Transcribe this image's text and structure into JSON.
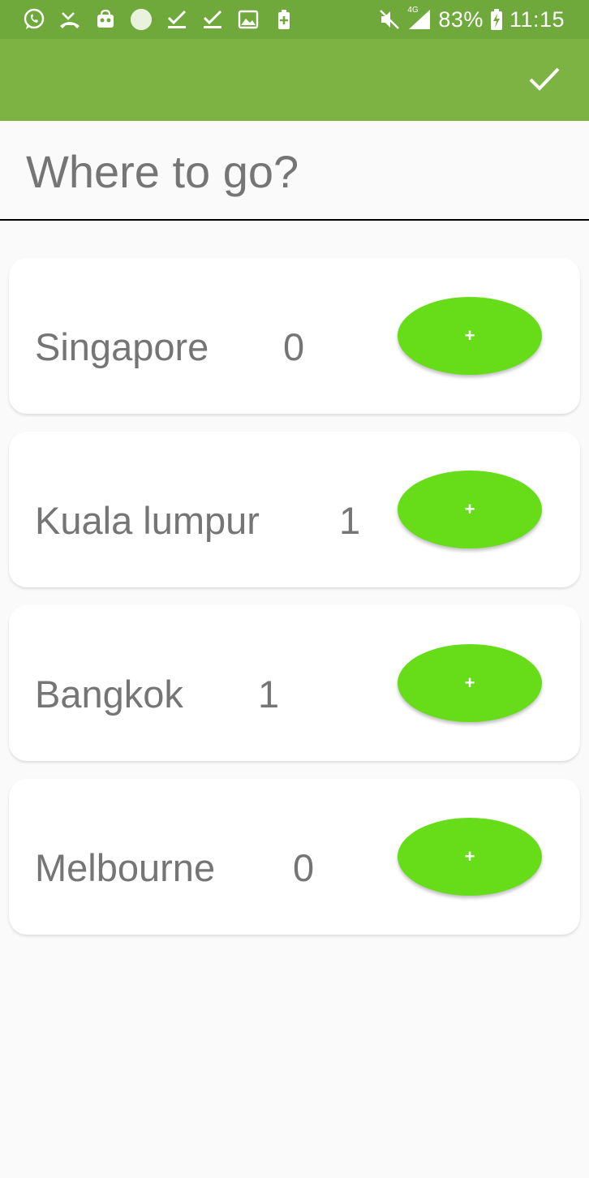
{
  "status_bar": {
    "icons_left": [
      "whatsapp-icon",
      "missed-call-icon",
      "shopping-bag-icon",
      "circle-icon",
      "download-done-icon",
      "download-done-icon",
      "image-icon",
      "battery-plus-icon"
    ],
    "network_label": "4G",
    "battery": "83%",
    "time": "11:15"
  },
  "app_bar": {
    "action_icon": "check-icon"
  },
  "header": {
    "title": "Where to go?"
  },
  "destinations": [
    {
      "name": "Singapore",
      "count": "0",
      "button_label": "+"
    },
    {
      "name": "Kuala lumpur",
      "count": "1",
      "button_label": "+"
    },
    {
      "name": "Bangkok",
      "count": "1",
      "button_label": "+"
    },
    {
      "name": "Melbourne",
      "count": "0",
      "button_label": "+"
    }
  ],
  "colors": {
    "status_bar": "#6fa93c",
    "app_bar": "#7cb342",
    "add_button": "#66dd18",
    "text": "#757575",
    "background": "#fafafa"
  }
}
